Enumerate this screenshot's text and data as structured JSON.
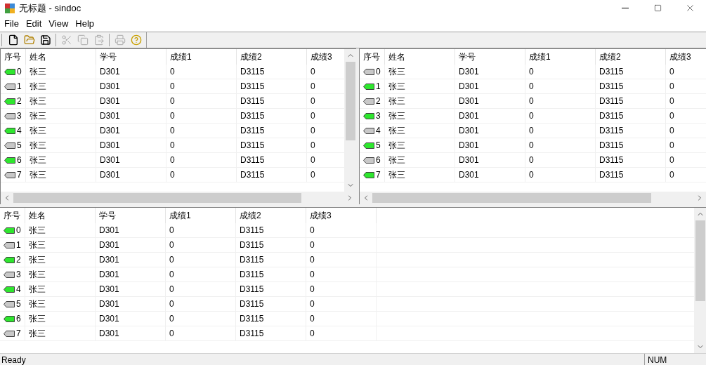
{
  "window": {
    "title": "无标题 - sindoc"
  },
  "menu": [
    "File",
    "Edit",
    "View",
    "Help"
  ],
  "toolbar": [
    {
      "kind": "new",
      "disabled": false
    },
    {
      "kind": "open",
      "disabled": false
    },
    {
      "kind": "save",
      "disabled": false
    },
    {
      "kind": "cut",
      "disabled": true
    },
    {
      "kind": "copy",
      "disabled": true
    },
    {
      "kind": "paste",
      "disabled": true
    },
    {
      "kind": "print",
      "disabled": true
    },
    {
      "kind": "help",
      "disabled": false
    }
  ],
  "panes": [
    {
      "columns": [
        "序号",
        "姓名",
        "学号",
        "成绩1",
        "成绩2",
        "成绩3"
      ],
      "rows": [
        {
          "lit": true,
          "cells": [
            "0",
            "张三",
            "D301",
            "0",
            "D3115",
            "0"
          ]
        },
        {
          "lit": false,
          "cells": [
            "1",
            "张三",
            "D301",
            "0",
            "D3115",
            "0"
          ]
        },
        {
          "lit": true,
          "cells": [
            "2",
            "张三",
            "D301",
            "0",
            "D3115",
            "0"
          ]
        },
        {
          "lit": false,
          "cells": [
            "3",
            "张三",
            "D301",
            "0",
            "D3115",
            "0"
          ]
        },
        {
          "lit": true,
          "cells": [
            "4",
            "张三",
            "D301",
            "0",
            "D3115",
            "0"
          ]
        },
        {
          "lit": false,
          "cells": [
            "5",
            "张三",
            "D301",
            "0",
            "D3115",
            "0"
          ]
        },
        {
          "lit": true,
          "cells": [
            "6",
            "张三",
            "D301",
            "0",
            "D3115",
            "0"
          ]
        },
        {
          "lit": false,
          "cells": [
            "7",
            "张三",
            "D301",
            "0",
            "D3115",
            "0"
          ]
        }
      ]
    },
    {
      "columns": [
        "序号",
        "姓名",
        "学号",
        "成绩1",
        "成绩2",
        "成绩3"
      ],
      "rows": [
        {
          "lit": false,
          "cells": [
            "0",
            "张三",
            "D301",
            "0",
            "D3115",
            "0"
          ]
        },
        {
          "lit": true,
          "cells": [
            "1",
            "张三",
            "D301",
            "0",
            "D3115",
            "0"
          ]
        },
        {
          "lit": false,
          "cells": [
            "2",
            "张三",
            "D301",
            "0",
            "D3115",
            "0"
          ]
        },
        {
          "lit": true,
          "cells": [
            "3",
            "张三",
            "D301",
            "0",
            "D3115",
            "0"
          ]
        },
        {
          "lit": false,
          "cells": [
            "4",
            "张三",
            "D301",
            "0",
            "D3115",
            "0"
          ]
        },
        {
          "lit": true,
          "cells": [
            "5",
            "张三",
            "D301",
            "0",
            "D3115",
            "0"
          ]
        },
        {
          "lit": false,
          "cells": [
            "6",
            "张三",
            "D301",
            "0",
            "D3115",
            "0"
          ]
        },
        {
          "lit": true,
          "cells": [
            "7",
            "张三",
            "D301",
            "0",
            "D3115",
            "0"
          ]
        }
      ]
    },
    {
      "columns": [
        "序号",
        "姓名",
        "学号",
        "成绩1",
        "成绩2",
        "成绩3"
      ],
      "rows": [
        {
          "lit": true,
          "cells": [
            "0",
            "张三",
            "D301",
            "0",
            "D3115",
            "0"
          ]
        },
        {
          "lit": false,
          "cells": [
            "1",
            "张三",
            "D301",
            "0",
            "D3115",
            "0"
          ]
        },
        {
          "lit": true,
          "cells": [
            "2",
            "张三",
            "D301",
            "0",
            "D3115",
            "0"
          ]
        },
        {
          "lit": false,
          "cells": [
            "3",
            "张三",
            "D301",
            "0",
            "D3115",
            "0"
          ]
        },
        {
          "lit": true,
          "cells": [
            "4",
            "张三",
            "D301",
            "0",
            "D3115",
            "0"
          ]
        },
        {
          "lit": false,
          "cells": [
            "5",
            "张三",
            "D301",
            "0",
            "D3115",
            "0"
          ]
        },
        {
          "lit": true,
          "cells": [
            "6",
            "张三",
            "D301",
            "0",
            "D3115",
            "0"
          ]
        },
        {
          "lit": false,
          "cells": [
            "7",
            "张三",
            "D301",
            "0",
            "D3115",
            "0"
          ]
        }
      ]
    }
  ],
  "status_bar": {
    "message": "Ready",
    "indicator": "NUM"
  }
}
